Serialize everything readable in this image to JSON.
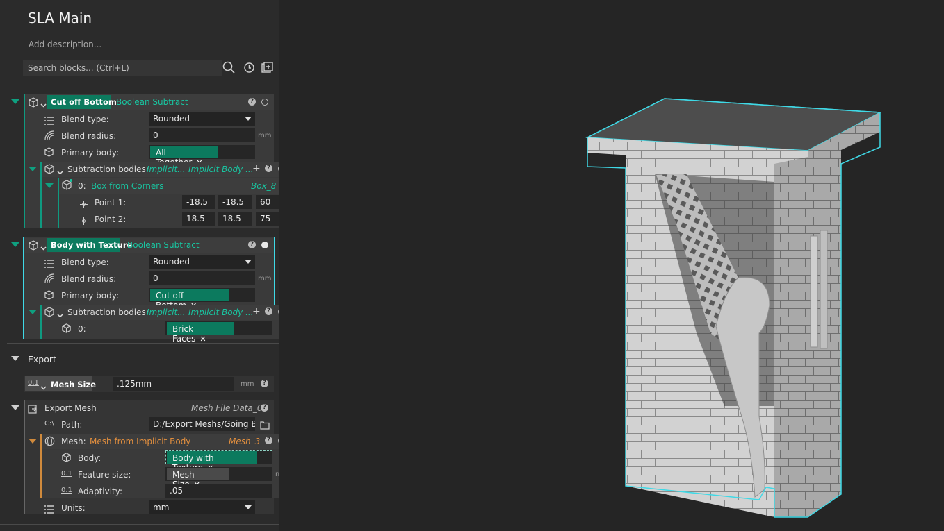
{
  "header": {
    "title": "SLA Main",
    "description_placeholder": "Add description...",
    "search_placeholder": "Search blocks... (Ctrl+L)"
  },
  "blocks": {
    "cut_off_bottom": {
      "name": "Cut off Bottom",
      "type": "Boolean Subtract",
      "blend_type_label": "Blend type:",
      "blend_type_value": "Rounded",
      "blend_radius_label": "Blend radius:",
      "blend_radius_value": "0",
      "unit": "mm",
      "primary_body_label": "Primary body:",
      "primary_body_value": "All Together",
      "subtraction_label": "Subtraction bodies:",
      "subtraction_type": "Implicit...",
      "subtraction_type2": "Implicit Body ...",
      "item_index": "0:",
      "item_name": "Box from Corners",
      "item_ref": "Box_8",
      "point1_label": "Point 1:",
      "point1": [
        "-18.5",
        "-18.5",
        "60"
      ],
      "point2_label": "Point 2:",
      "point2": [
        "18.5",
        "18.5",
        "75"
      ]
    },
    "body_with_texture": {
      "name": "Body with Texture",
      "type": "Boolean Subtract",
      "blend_type_label": "Blend type:",
      "blend_type_value": "Rounded",
      "blend_radius_label": "Blend radius:",
      "blend_radius_value": "0",
      "unit": "mm",
      "primary_body_label": "Primary body:",
      "primary_body_value": "Cut off Bottom",
      "subtraction_label": "Subtraction bodies:",
      "subtraction_type": "Implicit...",
      "subtraction_type2": "Implicit Body ...",
      "item_index": "0:",
      "item_value": "Brick Faces"
    }
  },
  "export": {
    "section_label": "Export",
    "mesh_size_label": "Mesh Size",
    "mesh_size_value": ".125mm",
    "unit": "mm",
    "export_mesh_label": "Export Mesh",
    "export_mesh_ref": "Mesh File Data_0",
    "path_label": "Path:",
    "path_value": "D:/Export Meshs/Going Be",
    "mesh_label": "Mesh:",
    "mesh_value": "Mesh from Implicit Body",
    "mesh_ref": "Mesh_3",
    "body_label": "Body:",
    "body_value": "Body with Texture",
    "feature_size_label": "Feature size:",
    "feature_size_value": "Mesh Size",
    "adaptivity_label": "Adaptivity:",
    "adaptivity_value": ".05",
    "units_label": "Units:",
    "units_value": "mm"
  },
  "icons": {
    "value_icon": "0.1",
    "path_icon": "C:\\"
  },
  "colors": {
    "accent_teal": "#19c4a0",
    "accent_orange": "#e28f3e",
    "selection_cyan": "#3fd9e6"
  }
}
